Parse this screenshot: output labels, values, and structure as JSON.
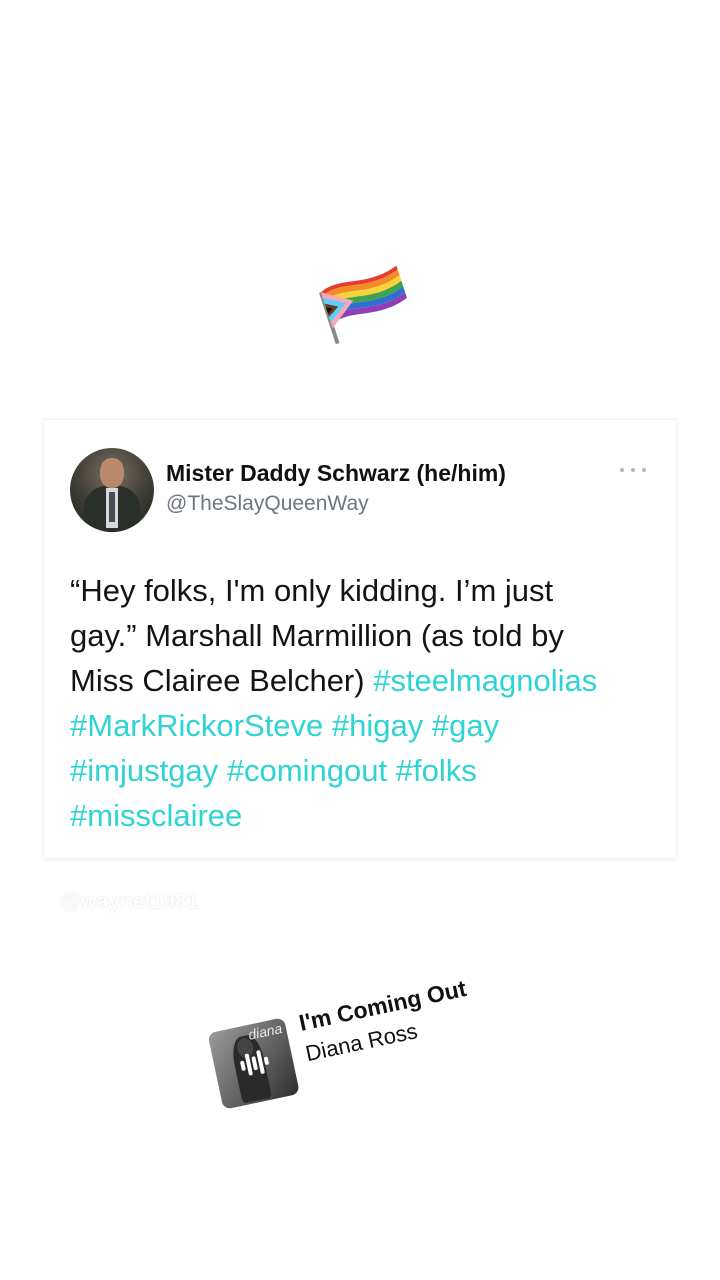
{
  "sticker": {
    "icon": "progress-pride-flag-icon"
  },
  "tweet": {
    "display_name": "Mister Daddy Schwarz (he/him)",
    "handle": "@TheSlayQueenWay",
    "text_part1": "“Hey folks, I'm only kidding. I’m just",
    "text_part2": "gay.” Marshall Marmillion (as told by",
    "text_part3": "Miss Clairee Belcher)",
    "hashtags": [
      "#steelmagnolias",
      "#MarkRickorSteve",
      "#higay",
      "#gay",
      "#imjustgay",
      "#comingout",
      "#folks",
      "#missclairee"
    ],
    "hashtag_color": "#2ed3d3"
  },
  "watermark": "@waynet1981",
  "music": {
    "title": "I'm Coming Out",
    "artist": "Diana Ross",
    "album_script": "diana"
  }
}
